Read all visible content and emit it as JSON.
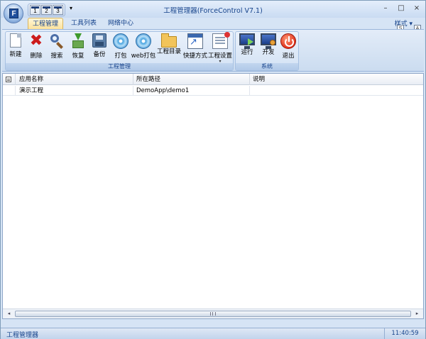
{
  "window": {
    "title": "工程管理器(ForceControl V7.1)",
    "app_logo": "F",
    "controls": {
      "minimize": "–",
      "maximize": "□",
      "close": "×"
    }
  },
  "quick_access": {
    "buttons": [
      "1",
      "2",
      "3"
    ],
    "more": "▾"
  },
  "tabs": [
    {
      "label": "工程管理",
      "active": true
    },
    {
      "label": "工具列表",
      "active": false
    },
    {
      "label": "网络中心",
      "active": false
    }
  ],
  "style_menu": {
    "label": "样式",
    "arrow": "▾",
    "badges": [
      "S",
      "A"
    ]
  },
  "ribbon": {
    "project_group": {
      "label": "工程管理",
      "buttons": [
        {
          "label": "新建",
          "icon": "new-doc-icon"
        },
        {
          "label": "删除",
          "icon": "delete-icon"
        },
        {
          "label": "搜索",
          "icon": "search-icon"
        },
        {
          "label": "恢复",
          "icon": "restore-icon"
        },
        {
          "label": "备份",
          "icon": "backup-icon"
        },
        {
          "label": "打包",
          "icon": "package-disc-icon"
        },
        {
          "label": "web打包",
          "icon": "web-package-disc-icon"
        },
        {
          "label": "工程目录",
          "icon": "folder-icon"
        },
        {
          "label": "快捷方式",
          "icon": "shortcut-icon"
        },
        {
          "label": "工程设置",
          "icon": "settings-icon",
          "dropdown": "▾"
        }
      ]
    },
    "system_group": {
      "label": "系统",
      "buttons": [
        {
          "label": "运行",
          "icon": "run-monitor-icon"
        },
        {
          "label": "开发",
          "icon": "develop-monitor-icon"
        },
        {
          "label": "退出",
          "icon": "power-icon"
        }
      ]
    }
  },
  "table": {
    "columns": [
      "应用名称",
      "所在路径",
      "说明"
    ],
    "rows": [
      {
        "name": "演示工程",
        "path": "DemoApp\\demo1",
        "desc": ""
      }
    ]
  },
  "scrollbar": {
    "left_arrow": "◂",
    "right_arrow": "▸"
  },
  "status": {
    "text": "工程管理器",
    "time": "11:40:59"
  },
  "colors": {
    "accent": "#15428b",
    "ribbon_bg": "#d6e4f5",
    "active_tab": "#fce29c"
  }
}
